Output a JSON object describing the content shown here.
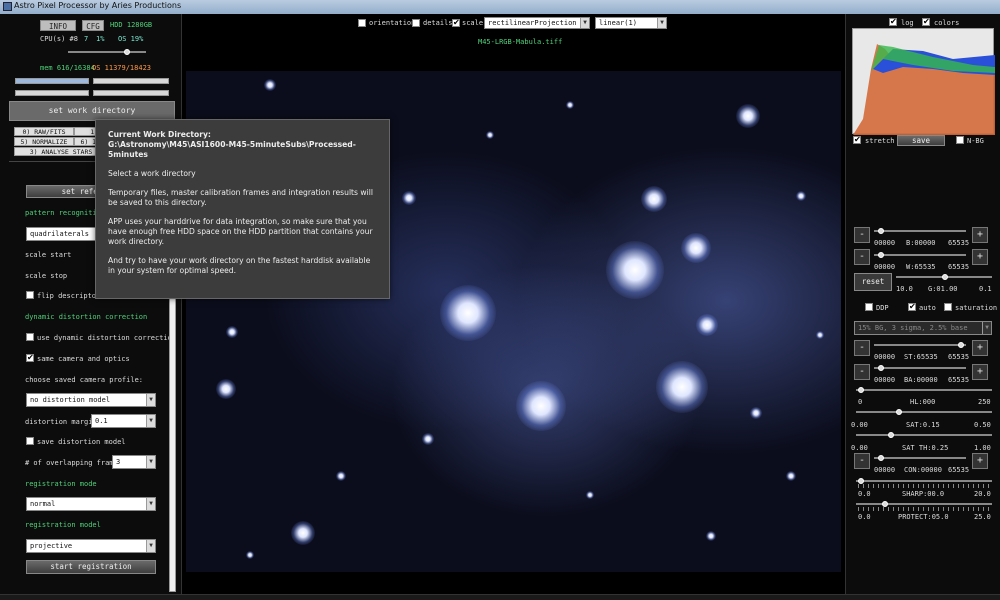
{
  "window": {
    "title": "Astro Pixel Processor by Aries Productions"
  },
  "top": {
    "info_label": "INFO",
    "cfg_label": "CFG",
    "hdd": "HDD 1280GB",
    "cpu_label": "CPU(s) #8",
    "cpu_val1": "7",
    "cpu_val2": "1%",
    "os_val": "OS 19%",
    "mem": "mem 616/16384",
    "os_mem": "OS 11379/18423",
    "set_work_dir": "set work directory"
  },
  "tabs": {
    "raw": "0) RAW/FITS",
    "load": "1) LOAD",
    "normalize": "5) NORMALIZE",
    "integrate": "6) INTEGRATE",
    "analyse": "3) ANALYSE STARS"
  },
  "panel": {
    "set_ref": "set reference",
    "pattern_recognition": "pattern recognition",
    "pattern_value": "quadrilaterals",
    "scale_start": "scale start",
    "scale_stop": "scale stop",
    "flip_descriptors": "flip descriptors",
    "dynamic_distortion": "dynamic distortion correction",
    "use_dynamic": "use dynamic distortion correction",
    "same_camera": "same camera and optics",
    "choose_profile": "choose saved camera profile:",
    "profile_value": "no distortion model",
    "distortion_margin": "distortion margin",
    "distortion_margin_value": "0.1",
    "save_distortion": "save distortion model",
    "overlapping_frames": "# of overlapping frames",
    "overlapping_value": "3",
    "registration_mode": "registration mode",
    "mode_value": "normal",
    "registration_model": "registration model",
    "model_value": "projective",
    "start_registration": "start registration"
  },
  "toolbar": {
    "orientation": "orientation",
    "details": "details",
    "scale": "scale",
    "projection": "rectilinearProjection",
    "stretch_mode": "linear(1)",
    "filename": "M45-LRGB-Mabula.tiff"
  },
  "tooltip": {
    "title": "Current Work Directory:",
    "path": "G:\\Astronomy\\M45\\ASI1600-M45-5minuteSubs\\Processed-5minutes",
    "p1": "Select a work directory",
    "p2": "Temporary files, master calibration frames and integration results will be saved to this directory.",
    "p3": "APP uses your harddrive for data integration, so make sure that you have enough free HDD space on the HDD partition that contains your work directory.",
    "p4": "And try to have your work directory on the fastest harddisk available in your system for optimal speed."
  },
  "right": {
    "log": "log",
    "colors": "colors",
    "stretch": "stretch",
    "save": "save",
    "nbg": "N-BG",
    "b_row": [
      "00000",
      "B:00000",
      "65535"
    ],
    "w_row": [
      "00000",
      "W:65535",
      "65535"
    ],
    "reset": "reset",
    "g_row": [
      "10.0",
      "G:01.00",
      "0.1"
    ],
    "ddp": "DDP",
    "auto": "auto",
    "saturation": "saturation",
    "stretch_preset": "15% BG, 3 sigma, 2.5% base",
    "st_row": [
      "00000",
      "ST:65535",
      "65535"
    ],
    "ba_row": [
      "00000",
      "BA:00000",
      "65535"
    ],
    "hl_row": [
      "0",
      "HL:000",
      "250"
    ],
    "sat_row": [
      "0.00",
      "SAT:0.15",
      "0.50"
    ],
    "satth_row": [
      "0.00",
      "SAT TH:0.25",
      "1.00"
    ],
    "con_row": [
      "00000",
      "CON:00000",
      "65535"
    ],
    "sharp_row": [
      "0.0",
      "SHARP:00.0",
      "20.0"
    ],
    "protect_row": [
      "0.0",
      "PROTECT:05.0",
      "25.0"
    ]
  },
  "colors": {
    "accent_green": "#4fd27a",
    "panel_bg": "#0c0c0c"
  }
}
